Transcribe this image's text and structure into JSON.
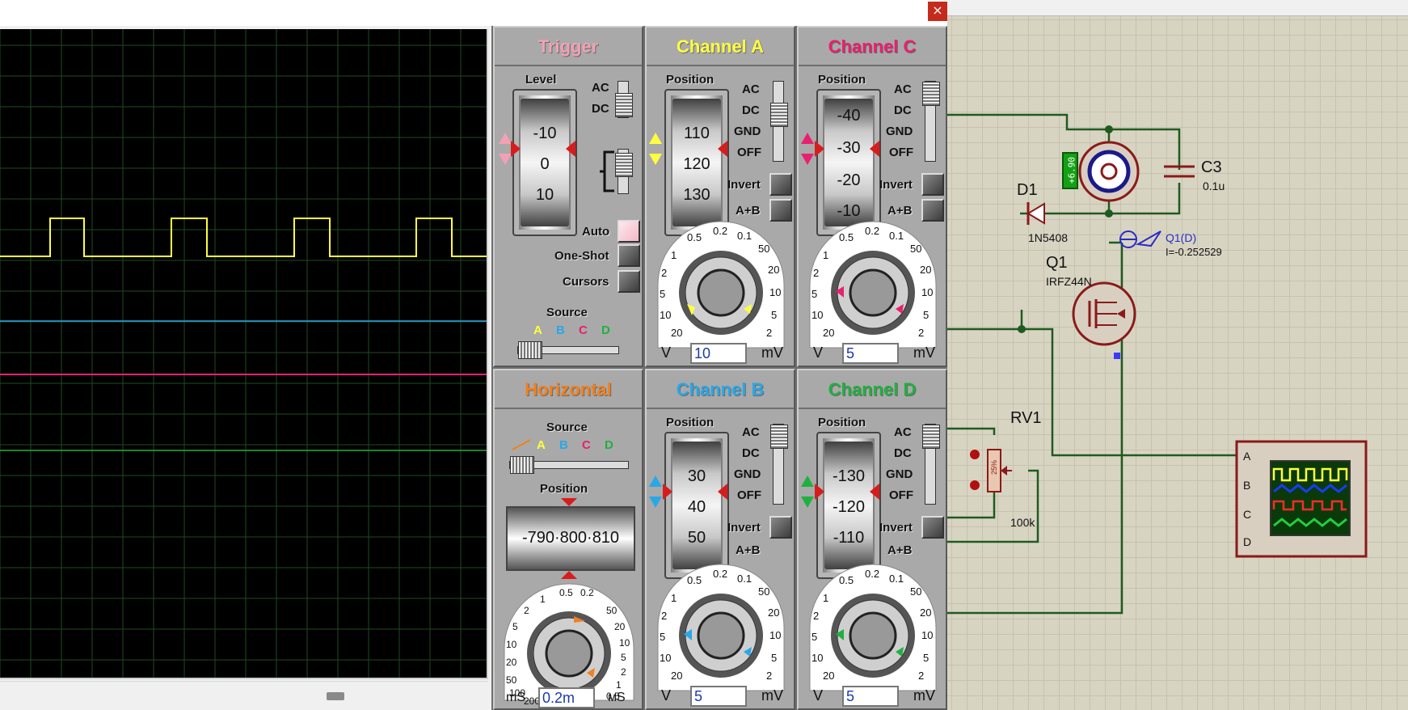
{
  "window": {
    "close_label": "×"
  },
  "trigger": {
    "title": "Trigger",
    "level_label": "Level",
    "drum_values": [
      "-10",
      "0",
      "10"
    ],
    "ac_label": "AC",
    "dc_label": "DC",
    "auto_label": "Auto",
    "oneshot_label": "One-Shot",
    "cursors_label": "Cursors",
    "source_label": "Source",
    "sources": [
      "A",
      "B",
      "C",
      "D"
    ]
  },
  "horizontal": {
    "title": "Horizontal",
    "source_label": "Source",
    "sources": [
      "A",
      "B",
      "C",
      "D"
    ],
    "position_label": "Position",
    "position_values": [
      "-790",
      "800",
      "810"
    ],
    "dial_labels": [
      "0.5",
      "0.2",
      "1",
      "2",
      "5",
      "10",
      "20",
      "50",
      "100",
      "200",
      "50",
      "20",
      "10",
      "5",
      "2",
      "1",
      "0.5"
    ],
    "value": "0.2m",
    "unit_left": "mS",
    "unit_right": "мS"
  },
  "channels": {
    "a": {
      "title": "Channel A",
      "position_label": "Position",
      "drum_values": [
        "110",
        "120",
        "130"
      ],
      "value": "10",
      "invert": "Invert",
      "aplusb": "A+B"
    },
    "b": {
      "title": "Channel B",
      "position_label": "Position",
      "drum_values": [
        "30",
        "40",
        "50"
      ],
      "value": "5",
      "invert": "Invert",
      "aplusb": "A+B"
    },
    "c": {
      "title": "Channel C",
      "position_label": "Position",
      "drum_values": [
        "-40",
        "-30",
        "-20",
        "-10"
      ],
      "value": "5",
      "invert": "Invert",
      "aplusb": "A+B"
    },
    "d": {
      "title": "Channel D",
      "position_label": "Position",
      "drum_values": [
        "-130",
        "-120",
        "-110"
      ],
      "value": "5",
      "invert": "Invert",
      "aplusb": "A+B"
    }
  },
  "coupling": {
    "ac": "AC",
    "dc": "DC",
    "gnd": "GND",
    "off": "OFF"
  },
  "volt_dial": {
    "labels": [
      "0.5",
      "0.2",
      "0.1",
      "1",
      "50",
      "2",
      "20",
      "5",
      "10",
      "10",
      "5",
      "20",
      "2"
    ],
    "unit_left": "V",
    "unit_right": "mV"
  },
  "schematic": {
    "c3_name": "C3",
    "c3_value": "0.1u",
    "d1_name": "D1",
    "d1_value": "1N5408",
    "q1_name": "Q1",
    "q1_value": "IRFZ44N",
    "probe_label": "Q1(D)",
    "probe_value": "I=-0.252529",
    "rv1_name": "RV1",
    "rv1_value": "100k",
    "rv1_pct": "25%",
    "motor_readout": "+6.90",
    "scope_pins": [
      "A",
      "B",
      "C",
      "D"
    ]
  },
  "colors": {
    "a": "#ffff40",
    "b": "#2aa7e8",
    "c": "#e8206e",
    "d": "#20b040",
    "trigger": "#f2a1b4",
    "horizontal": "#f08020"
  }
}
